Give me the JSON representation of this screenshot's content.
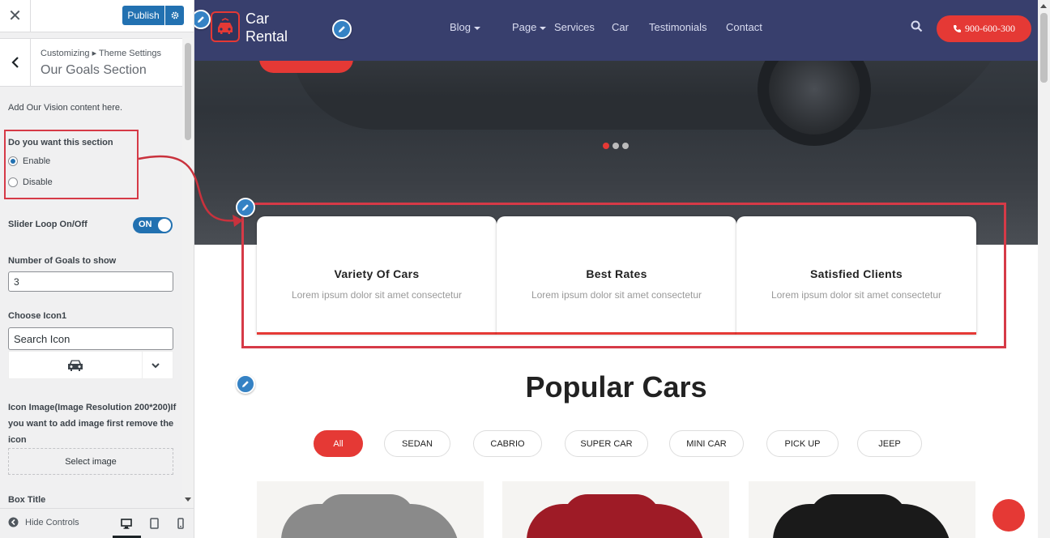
{
  "customizer": {
    "close_label": "✕",
    "publish_label": "Publish",
    "breadcrumb": "Customizing ▸ Theme Settings",
    "section_title": "Our Goals Section",
    "description": "Add Our Vision content here.",
    "section_toggle": {
      "label": "Do you want this section",
      "options": [
        "Enable",
        "Disable"
      ],
      "selected": "Enable"
    },
    "slider_loop": {
      "label": "Slider Loop On/Off",
      "state": "ON"
    },
    "goals_count": {
      "label": "Number of Goals to show",
      "value": "3"
    },
    "choose_icon": {
      "label": "Choose Icon1",
      "placeholder": "Search Icon",
      "selected_icon": "car-icon"
    },
    "icon_image": {
      "label": "Icon Image(Image Resolution 200*200)If you want to add image first remove the icon",
      "button": "Select image"
    },
    "box_title_label": "Box Title",
    "hide_controls": "Hide Controls",
    "devices": [
      "desktop-icon",
      "tablet-icon",
      "mobile-icon"
    ],
    "accent": "#2271b1"
  },
  "site": {
    "brand": {
      "line1": "Car",
      "line2": "Rental",
      "logo_icon": "car-logo-icon"
    },
    "nav": [
      {
        "label": "Blog",
        "dropdown": true
      },
      {
        "label": "Page",
        "dropdown": true
      },
      {
        "label": "Services",
        "dropdown": false
      },
      {
        "label": "Car",
        "dropdown": false
      },
      {
        "label": "Testimonials",
        "dropdown": false
      },
      {
        "label": "Contact",
        "dropdown": false
      }
    ],
    "phone": "900-600-300",
    "slider": {
      "slides": 3,
      "active_slide": 1
    },
    "goals": [
      {
        "title": "Variety Of Cars",
        "desc": "Lorem ipsum dolor sit amet consectetur"
      },
      {
        "title": "Best Rates",
        "desc": "Lorem ipsum dolor sit amet consectetur"
      },
      {
        "title": "Satisfied Clients",
        "desc": "Lorem ipsum dolor sit amet consectetur"
      }
    ],
    "popular_title": "Popular Cars",
    "filters": [
      "All",
      "SEDAN",
      "CABRIO",
      "SUPER CAR",
      "MINI CAR",
      "PICK UP",
      "JEEP"
    ],
    "active_filter": "All",
    "car_colors": [
      "#8a8a8a",
      "#9e1b26",
      "#1a1a1a"
    ],
    "brand_color": "#e53935",
    "nav_bg": "#383f6d"
  }
}
